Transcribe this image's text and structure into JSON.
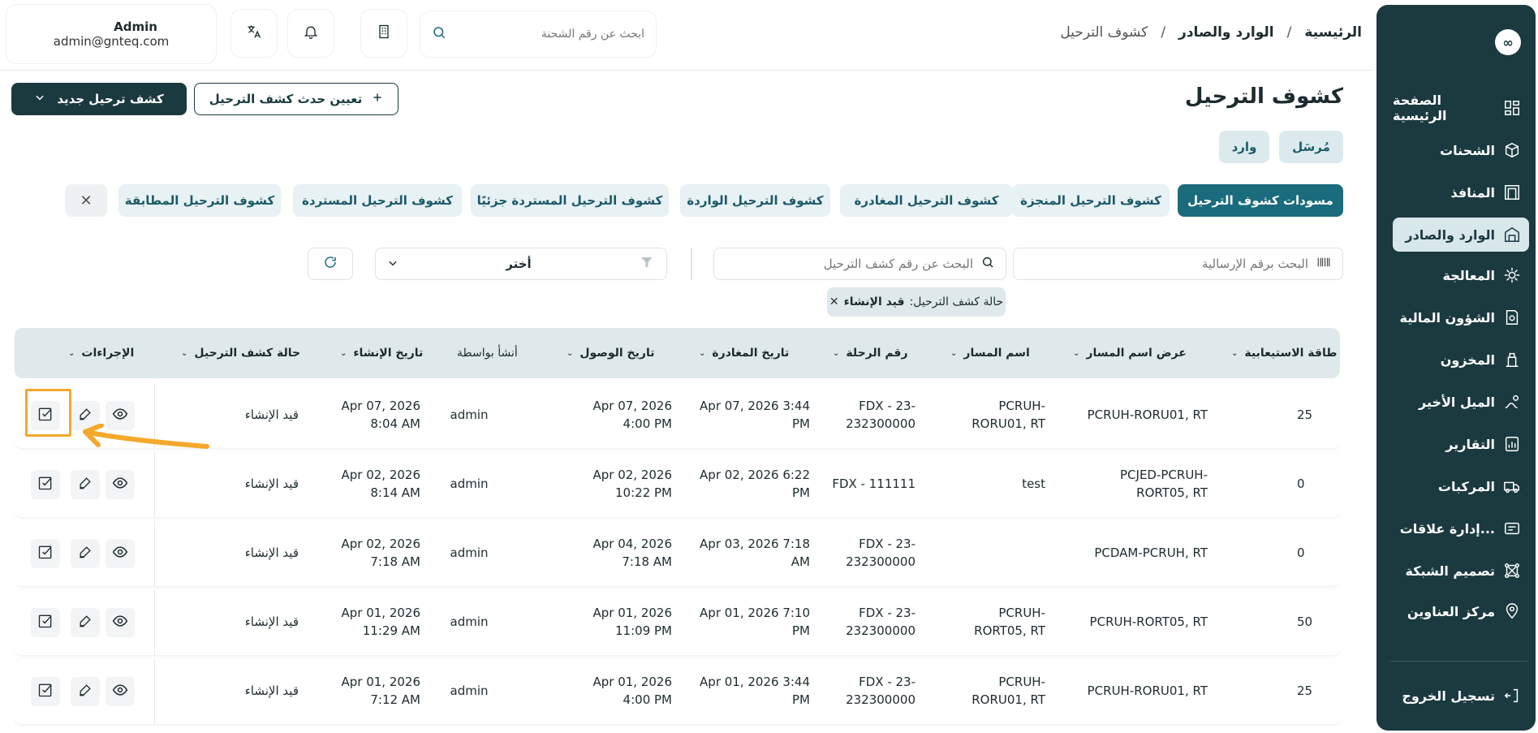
{
  "sidebar": {
    "logo": "∞",
    "items": [
      {
        "label": "الصفحة الرئيسية",
        "icon": "dashboard-icon"
      },
      {
        "label": "الشحنات",
        "icon": "package-icon"
      },
      {
        "label": "المنافذ",
        "icon": "building-icon"
      },
      {
        "label": "الوارد والصادر",
        "icon": "warehouse-icon",
        "active": true
      },
      {
        "label": "المعالجة",
        "icon": "processing-icon"
      },
      {
        "label": "الشؤون المالية",
        "icon": "finance-icon"
      },
      {
        "label": "المخزون",
        "icon": "inventory-icon"
      },
      {
        "label": "الميل الأخير",
        "icon": "last-mile-icon"
      },
      {
        "label": "التقارير",
        "icon": "reports-icon"
      },
      {
        "label": "المركبات",
        "icon": "truck-icon"
      },
      {
        "label": "إدارة علاقات...",
        "icon": "crm-icon"
      },
      {
        "label": "تصميم الشبكة",
        "icon": "network-icon"
      },
      {
        "label": "مركز العناوين",
        "icon": "location-icon"
      }
    ],
    "logout": "تسجيل الخروج"
  },
  "topbar": {
    "user_name": "Admin",
    "user_email": "admin@gnteq.com",
    "search_placeholder": "ابحث عن رقم الشحنة"
  },
  "breadcrumb": {
    "home": "الرئيسية",
    "section": "الوارد والصادر",
    "current": "كشوف الترحيل",
    "sep": "/"
  },
  "page": {
    "title": "كشوف الترحيل",
    "new_button": "كشف ترحيل جديد",
    "assign_button": "تعيين حدث كشف الترحيل",
    "toggle_sent": "مُرسَل",
    "toggle_incoming": "وارد"
  },
  "tabs": [
    "مسودات كشوف الترحيل",
    "كشوف الترحيل المنجزة",
    "كشوف الترحيل المغادرة",
    "كشوف الترحيل الواردة",
    "كشوف الترحيل المستردة جزئيًا",
    "كشوف الترحيل المستردة",
    "كشوف الترحيل المطابقة"
  ],
  "filters": {
    "waybill_placeholder": "البحث برقم الإرسالية",
    "manifest_placeholder": "البحث عن رقم كشف الترحيل",
    "select_value": "أختر",
    "chip_label": "حالة كشف الترحيل:",
    "chip_value": "قيد الإنشاء"
  },
  "table": {
    "headers": {
      "capacity": "طاقة الاستيعابية",
      "route_display": "عرض اسم المسار",
      "route_name": "اسم المسار",
      "flight": "رقم الرحلة",
      "departure": "تاريخ المغادرة",
      "arrival": "تاريخ الوصول",
      "created_by": "أنشأ بواسطة",
      "created_at": "تاريخ الإنشاء",
      "status": "حالة كشف الترحيل",
      "actions": "الإجراءات"
    },
    "rows": [
      {
        "capacity": "25",
        "route_display": "PCRUH-RORU01, RT",
        "route_name": "PCRUH-\nRORU01, RT",
        "flight": "FDX - 23-\n232300000",
        "departure": "Apr 07, 2026 3:44\nPM",
        "arrival": "Apr 07, 2026\n4:00 PM",
        "created_by": "admin",
        "created_at": "Apr 07, 2026\n8:04 AM",
        "status": "قيد الإنشاء"
      },
      {
        "capacity": "0",
        "route_display": "PCJED-PCRUH-\nRORT05, RT",
        "route_name": "test",
        "flight": "FDX - 111111",
        "departure": "Apr 02, 2026 6:22\nPM",
        "arrival": "Apr 02, 2026\n10:22 PM",
        "created_by": "admin",
        "created_at": "Apr 02, 2026\n8:14 AM",
        "status": "قيد الإنشاء"
      },
      {
        "capacity": "0",
        "route_display": "PCDAM-PCRUH, RT",
        "route_name": "",
        "flight": "FDX - 23-\n232300000",
        "departure": "Apr 03, 2026 7:18\nAM",
        "arrival": "Apr 04, 2026\n7:18 AM",
        "created_by": "admin",
        "created_at": "Apr 02, 2026\n7:18 AM",
        "status": "قيد الإنشاء"
      },
      {
        "capacity": "50",
        "route_display": "PCRUH-RORT05, RT",
        "route_name": "PCRUH-\nRORT05, RT",
        "flight": "FDX - 23-\n232300000",
        "departure": "Apr 01, 2026 7:10\nPM",
        "arrival": "Apr 01, 2026\n11:09 PM",
        "created_by": "admin",
        "created_at": "Apr 01, 2026\n11:29 AM",
        "status": "قيد الإنشاء"
      },
      {
        "capacity": "25",
        "route_display": "PCRUH-RORU01, RT",
        "route_name": "PCRUH-\nRORU01, RT",
        "flight": "FDX - 23-\n232300000",
        "departure": "Apr 01, 2026 3:44\nPM",
        "arrival": "Apr 01, 2026\n4:00 PM",
        "created_by": "admin",
        "created_at": "Apr 01, 2026\n7:12 AM",
        "status": "قيد الإنشاء"
      }
    ]
  },
  "colors": {
    "sidebar_bg": "#1b3a40",
    "accent": "#1a6b7c",
    "highlight": "#f5a82c"
  }
}
